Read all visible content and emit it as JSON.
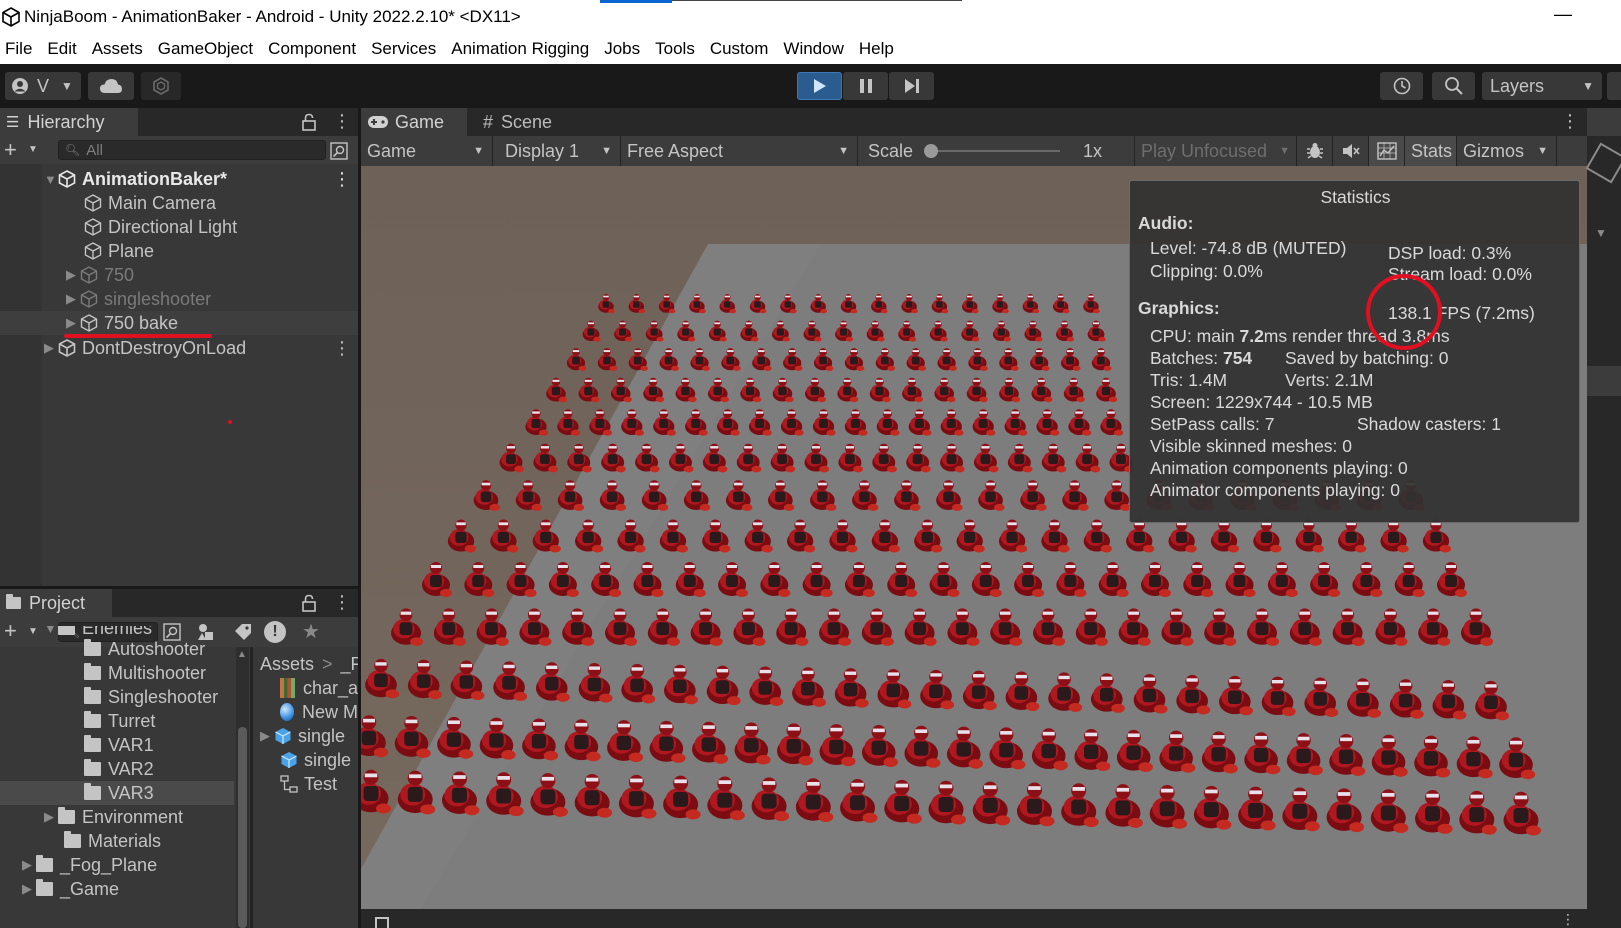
{
  "window": {
    "title": "NinjaBoom - AnimationBaker - Android - Unity 2022.2.10* <DX11>",
    "minimize": "—"
  },
  "menu": [
    "File",
    "Edit",
    "Assets",
    "GameObject",
    "Component",
    "Services",
    "Animation Rigging",
    "Jobs",
    "Tools",
    "Custom",
    "Window",
    "Help"
  ],
  "toolbar": {
    "account": "V",
    "layers": "Layers"
  },
  "hierarchy": {
    "tab": "Hierarchy",
    "search_placeholder": "All",
    "scene": "AnimationBaker*",
    "items": [
      "Main Camera",
      "Directional Light",
      "Plane",
      "750",
      "singleshooter",
      "750 bake"
    ],
    "dontdestroy": "DontDestroyOnLoad"
  },
  "project": {
    "tab": "Project",
    "folders": [
      "Enemies",
      "Autoshooter",
      "Multishooter",
      "Singleshooter",
      "Turret",
      "VAR1",
      "VAR2",
      "VAR3",
      "Environment",
      "Materials",
      "_Fog_Plane",
      "_Game"
    ],
    "breadcrumb": "Assets",
    "breadcrumb_next": "_F",
    "assets": [
      "char_a",
      "New M",
      "single",
      "single",
      "Test"
    ]
  },
  "game": {
    "tab_game": "Game",
    "tab_scene": "Scene",
    "display_mode": "Game",
    "display": "Display 1",
    "aspect": "Free Aspect",
    "scale_label": "Scale",
    "scale_value": "1x",
    "play_mode": "Play Unfocused",
    "stats_btn": "Stats",
    "gizmos_btn": "Gizmos"
  },
  "stats": {
    "title": "Statistics",
    "audio_header": "Audio:",
    "level": "Level: -74.8 dB (MUTED)",
    "clipping": "Clipping: 0.0%",
    "dsp": "DSP load: 0.3%",
    "stream": "Stream load: 0.0%",
    "graphics_header": "Graphics:",
    "fps": "138.1 FPS (7.2ms)",
    "cpu_prefix": "CPU: main ",
    "cpu_main": "7.2",
    "cpu_suffix": "ms  render thread 3.8ms",
    "batches_prefix": "Batches: ",
    "batches": "754",
    "saved": "Saved by batching: 0",
    "tris": "Tris: 1.4M",
    "verts": "Verts: 2.1M",
    "screen": "Screen: 1229x744 - 10.5 MB",
    "setpass": "SetPass calls: 7",
    "shadow": "Shadow casters: 1",
    "skinned": "Visible skinned meshes: 0",
    "anim": "Animation components playing: 0",
    "animator": "Animator components playing: 0"
  },
  "colors": {
    "highlight": "#e01020",
    "play_active": "#2a5c8f",
    "panel_bg": "#383838"
  }
}
